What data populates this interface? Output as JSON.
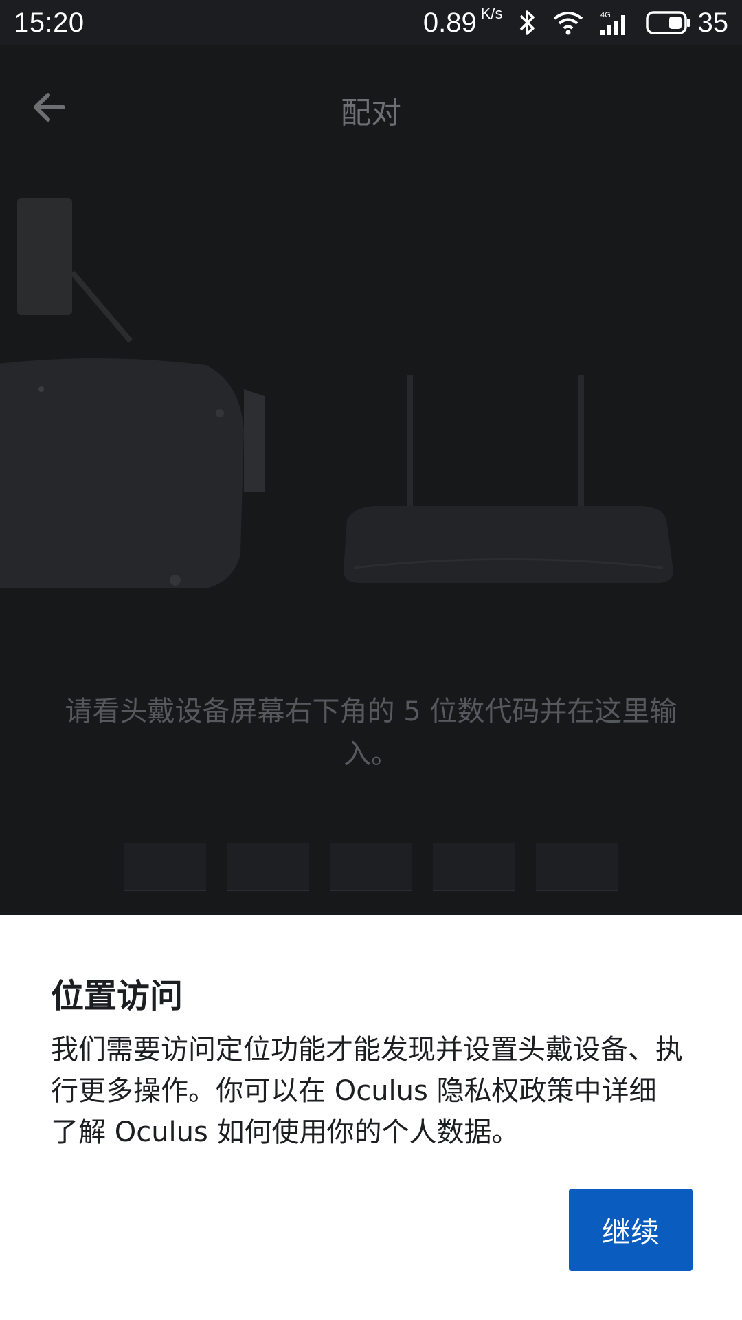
{
  "status_bar": {
    "time": "15:20",
    "net_speed": "0.89",
    "net_speed_unit": "K/s",
    "network_type": "4G",
    "battery_level": "35"
  },
  "screen": {
    "title": "配对",
    "instruction": "请看头戴设备屏幕右下角的 5 位数代码并在这里输入。",
    "code_digits": [
      "",
      "",
      "",
      "",
      ""
    ]
  },
  "sheet": {
    "title": "位置访问",
    "body": "我们需要访问定位功能才能发现并设置头戴设备、执行更多操作。你可以在 Oculus 隐私权政策中详细了解 Oculus 如何使用你的个人数据。",
    "continue_label": "继续"
  },
  "colors": {
    "accent": "#0a5cbf",
    "sheet_bg": "#ffffff",
    "dim_bg": "#17181a"
  }
}
